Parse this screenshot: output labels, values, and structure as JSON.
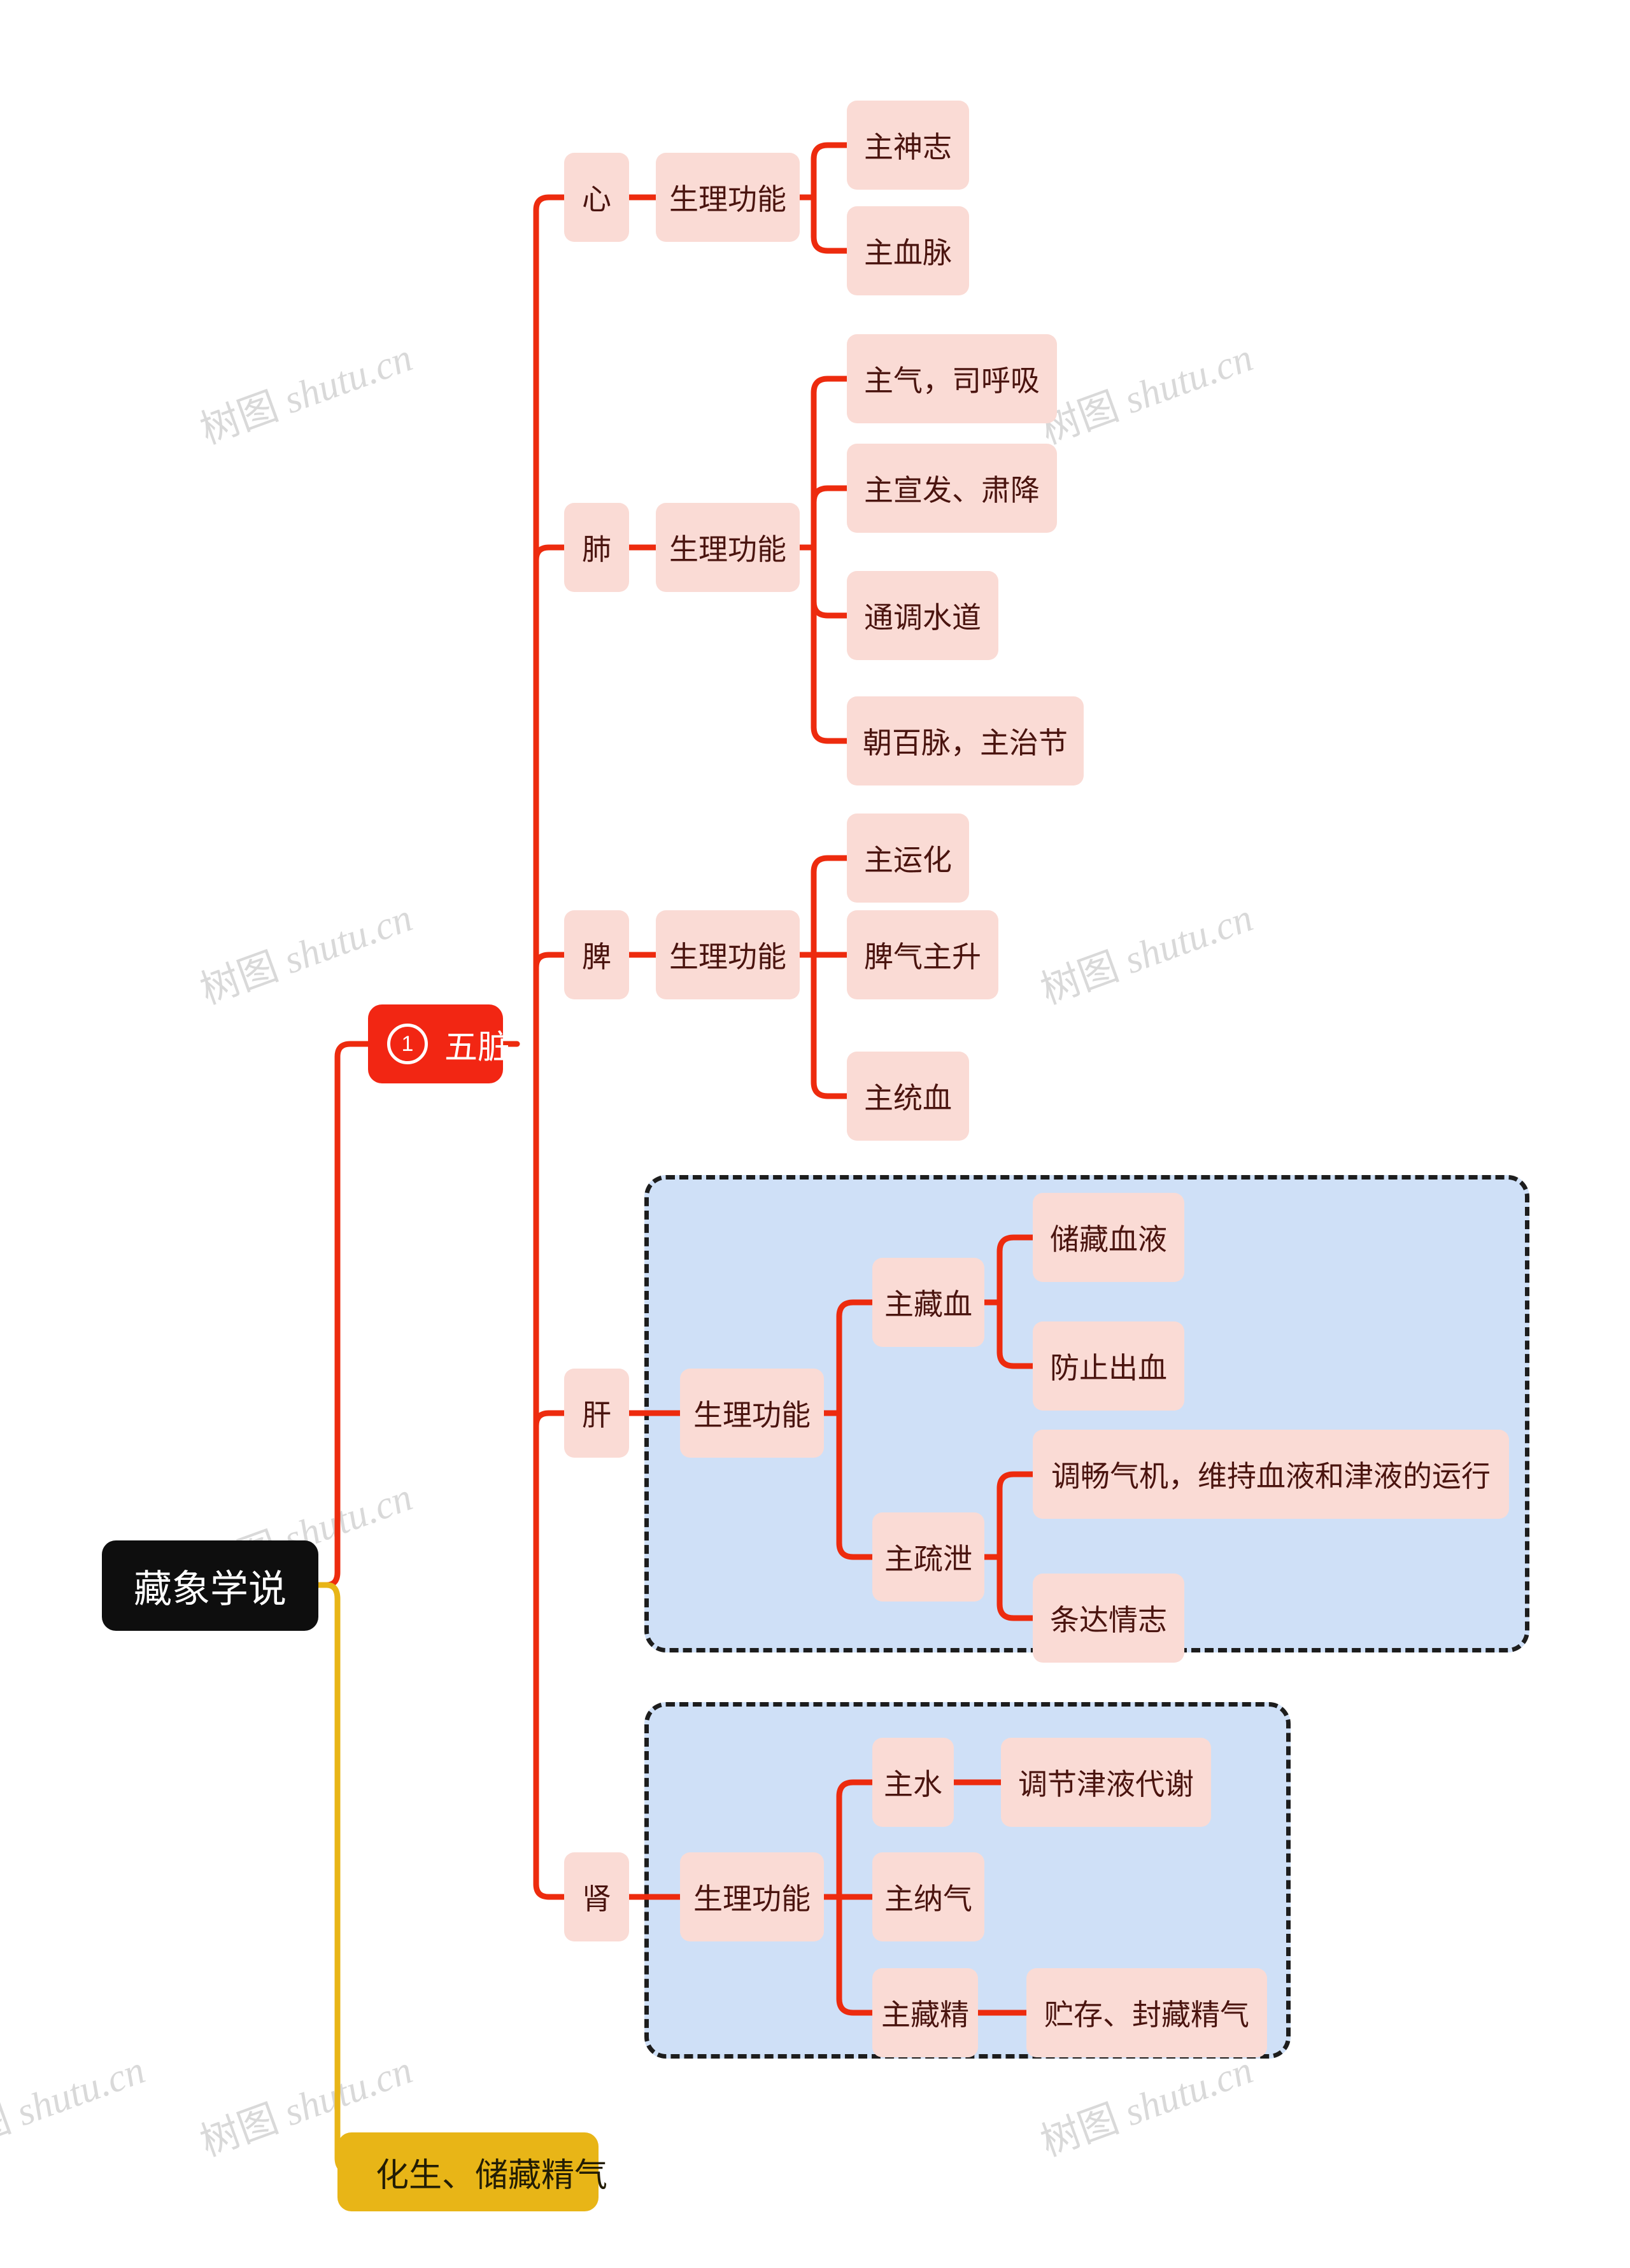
{
  "document": {
    "title": "藏象学说",
    "type": "mind-map"
  },
  "watermark": {
    "text": "树图 shutu.cn",
    "color": "#d8d8d8"
  },
  "colors": {
    "root_bg": "#0e0e0e",
    "root_text": "#ffffff",
    "branch_red": "#F22613",
    "link_red": "#ED2B0E",
    "link_yellow": "#E8B517",
    "node_pink_bg": "#fadbd5",
    "node_pink_text": "#4a140f",
    "group_bg": "#cfe0f7",
    "group_border": "#1d1d1d",
    "yellow_bg": "#E8B517"
  },
  "root": {
    "label": "藏象学说"
  },
  "branches": [
    {
      "id": "wuzang",
      "label": "五脏",
      "badge": "1",
      "style": "red"
    },
    {
      "id": "huasheng",
      "label": "化生、储藏精气",
      "style": "yellow"
    }
  ],
  "organs": [
    {
      "id": "xin",
      "label": "心",
      "function_label": "生理功能",
      "boxed": false,
      "items": [
        {
          "label": "主神志",
          "children": []
        },
        {
          "label": "主血脉",
          "children": []
        }
      ]
    },
    {
      "id": "fei",
      "label": "肺",
      "function_label": "生理功能",
      "boxed": false,
      "items": [
        {
          "label": "主气，司呼吸",
          "children": []
        },
        {
          "label": "主宣发、肃降",
          "children": []
        },
        {
          "label": "通调水道",
          "children": []
        },
        {
          "label": "朝百脉，主治节",
          "children": []
        }
      ]
    },
    {
      "id": "pi",
      "label": "脾",
      "function_label": "生理功能",
      "boxed": false,
      "items": [
        {
          "label": "主运化",
          "children": []
        },
        {
          "label": "脾气主升",
          "children": []
        },
        {
          "label": "主统血",
          "children": []
        }
      ]
    },
    {
      "id": "gan",
      "label": "肝",
      "function_label": "生理功能",
      "boxed": true,
      "items": [
        {
          "label": "主藏血",
          "children": [
            "储藏血液",
            "防止出血"
          ]
        },
        {
          "label": "主疏泄",
          "children": [
            "调畅气机，维持血液和津液的运行",
            "条达情志"
          ]
        }
      ]
    },
    {
      "id": "shen",
      "label": "肾",
      "function_label": "生理功能",
      "boxed": true,
      "items": [
        {
          "label": "主水",
          "children": [
            "调节津液代谢"
          ]
        },
        {
          "label": "主纳气",
          "children": []
        },
        {
          "label": "主藏精",
          "children": [
            "贮存、封藏精气"
          ]
        }
      ]
    }
  ],
  "labels": {
    "xin": "心",
    "fei": "肺",
    "pi": "脾",
    "gan": "肝",
    "shen": "肾",
    "fn": "生理功能",
    "xin_1": "主神志",
    "xin_2": "主血脉",
    "fei_1": "主气，司呼吸",
    "fei_2": "主宣发、肃降",
    "fei_3": "通调水道",
    "fei_4": "朝百脉，主治节",
    "pi_1": "主运化",
    "pi_2": "脾气主升",
    "pi_3": "主统血",
    "gan_1": "主藏血",
    "gan_1a": "储藏血液",
    "gan_1b": "防止出血",
    "gan_2": "主疏泄",
    "gan_2a": "调畅气机，维持血液和津液的运行",
    "gan_2b": "条达情志",
    "shen_1": "主水",
    "shen_1a": "调节津液代谢",
    "shen_2": "主纳气",
    "shen_3": "主藏精",
    "shen_3a": "贮存、封藏精气",
    "root": "藏象学说",
    "wuzang": "五脏",
    "wuzang_badge": "1",
    "huasheng": "化生、储藏精气"
  }
}
